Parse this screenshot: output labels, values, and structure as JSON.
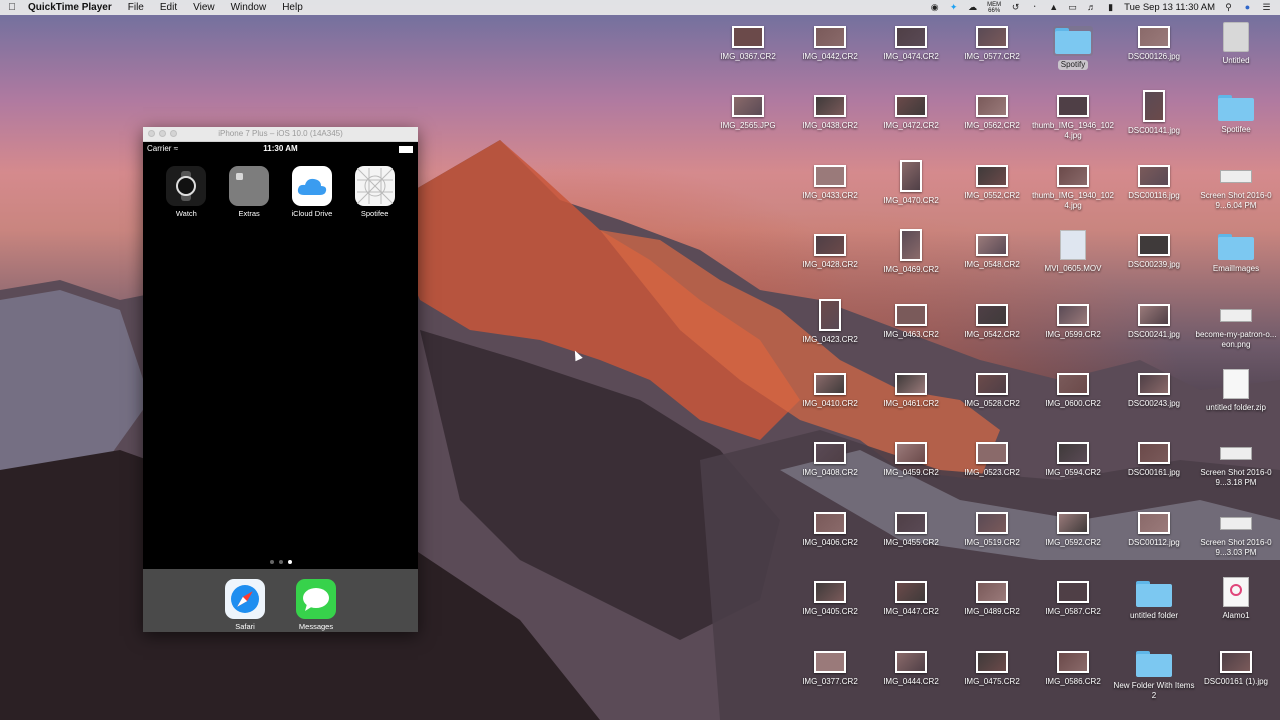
{
  "menubar": {
    "app_name": "QuickTime Player",
    "menus": [
      "File",
      "Edit",
      "View",
      "Window",
      "Help"
    ],
    "status": {
      "mem_label": "MEM",
      "mem_value": "66%",
      "clock": "Tue Sep 13  11:30 AM"
    }
  },
  "simulator": {
    "title": "iPhone 7 Plus – iOS 10.0 (14A345)",
    "carrier": "Carrier",
    "time": "11:30 AM",
    "apps": [
      {
        "label": "Watch",
        "icon": "watch-icon",
        "color": "#222222"
      },
      {
        "label": "Extras",
        "icon": "folder-extras-icon",
        "color": "#7d7d7d"
      },
      {
        "label": "iCloud Drive",
        "icon": "icloud-icon",
        "color": "#ffffff"
      },
      {
        "label": "Spotifee",
        "icon": "spotifee-icon",
        "color": "#f2f2f2"
      }
    ],
    "dock": [
      {
        "label": "Safari",
        "icon": "safari-icon",
        "color": "#e8f1fb"
      },
      {
        "label": "Messages",
        "icon": "messages-icon",
        "color": "#37d24b"
      }
    ],
    "pages": 3,
    "current_page": 3
  },
  "desktop": {
    "columns": [
      [
        {
          "label": "IMG_0367.CR2",
          "type": "photo"
        },
        {
          "label": "IMG_2565.JPG",
          "type": "photo"
        }
      ],
      [
        {
          "label": "IMG_0442.CR2",
          "type": "photo"
        },
        {
          "label": "IMG_0438.CR2",
          "type": "photo"
        },
        {
          "label": "IMG_0433.CR2",
          "type": "photo"
        },
        {
          "label": "IMG_0428.CR2",
          "type": "photo"
        },
        {
          "label": "IMG_0423.CR2",
          "type": "photo-tall"
        },
        {
          "label": "IMG_0410.CR2",
          "type": "photo"
        },
        {
          "label": "IMG_0408.CR2",
          "type": "photo"
        },
        {
          "label": "IMG_0406.CR2",
          "type": "photo"
        },
        {
          "label": "IMG_0405.CR2",
          "type": "photo"
        },
        {
          "label": "IMG_0377.CR2",
          "type": "photo"
        }
      ],
      [
        {
          "label": "IMG_0474.CR2",
          "type": "photo"
        },
        {
          "label": "IMG_0472.CR2",
          "type": "photo"
        },
        {
          "label": "IMG_0470.CR2",
          "type": "photo-tall"
        },
        {
          "label": "IMG_0469.CR2",
          "type": "photo-tall"
        },
        {
          "label": "IMG_0463.CR2",
          "type": "photo"
        },
        {
          "label": "IMG_0461.CR2",
          "type": "photo"
        },
        {
          "label": "IMG_0459.CR2",
          "type": "photo"
        },
        {
          "label": "IMG_0455.CR2",
          "type": "photo"
        },
        {
          "label": "IMG_0447.CR2",
          "type": "photo"
        },
        {
          "label": "IMG_0444.CR2",
          "type": "photo"
        }
      ],
      [
        {
          "label": "IMG_0577.CR2",
          "type": "photo"
        },
        {
          "label": "IMG_0562.CR2",
          "type": "photo"
        },
        {
          "label": "IMG_0552.CR2",
          "type": "photo"
        },
        {
          "label": "IMG_0548.CR2",
          "type": "photo"
        },
        {
          "label": "IMG_0542.CR2",
          "type": "photo"
        },
        {
          "label": "IMG_0528.CR2",
          "type": "photo"
        },
        {
          "label": "IMG_0523.CR2",
          "type": "photo"
        },
        {
          "label": "IMG_0519.CR2",
          "type": "photo"
        },
        {
          "label": "IMG_0489.CR2",
          "type": "photo"
        },
        {
          "label": "IMG_0475.CR2",
          "type": "photo"
        }
      ],
      [
        {
          "label": "Spotify",
          "type": "folder",
          "selected": true
        },
        {
          "label": "thumb_IMG_1946_1024.jpg",
          "type": "photo"
        },
        {
          "label": "thumb_IMG_1940_1024.jpg",
          "type": "photo"
        },
        {
          "label": "MVI_0605.MOV",
          "type": "movie"
        },
        {
          "label": "IMG_0599.CR2",
          "type": "photo"
        },
        {
          "label": "IMG_0600.CR2",
          "type": "photo"
        },
        {
          "label": "IMG_0594.CR2",
          "type": "photo"
        },
        {
          "label": "IMG_0592.CR2",
          "type": "photo"
        },
        {
          "label": "IMG_0587.CR2",
          "type": "photo"
        },
        {
          "label": "IMG_0586.CR2",
          "type": "photo"
        }
      ],
      [
        {
          "label": "DSC00126.jpg",
          "type": "photo"
        },
        {
          "label": "DSC00141.jpg",
          "type": "photo-tall"
        },
        {
          "label": "DSC00116.jpg",
          "type": "photo"
        },
        {
          "label": "DSC00239.jpg",
          "type": "photo"
        },
        {
          "label": "DSC00241.jpg",
          "type": "photo"
        },
        {
          "label": "DSC00243.jpg",
          "type": "photo"
        },
        {
          "label": "DSC00161.jpg",
          "type": "photo"
        },
        {
          "label": "DSC00112.jpg",
          "type": "photo"
        },
        {
          "label": "untitled folder",
          "type": "folder"
        },
        {
          "label": "New Folder With Items 2",
          "type": "folder"
        }
      ],
      [
        {
          "label": "Untitled",
          "type": "drive"
        },
        {
          "label": "Spotifee",
          "type": "folder"
        },
        {
          "label": "Screen Shot 2016-09...6.04 PM",
          "type": "screenshot"
        },
        {
          "label": "EmailImages",
          "type": "folder"
        },
        {
          "label": "become-my-patron-o...eon.png",
          "type": "screenshot"
        },
        {
          "label": "untitled folder.zip",
          "type": "zip"
        },
        {
          "label": "Screen Shot 2016-09...3.18 PM",
          "type": "screenshot"
        },
        {
          "label": "Screen Shot 2016-09...3.03 PM",
          "type": "screenshot"
        },
        {
          "label": "Alamo1",
          "type": "audio"
        },
        {
          "label": "DSC00161 (1).jpg",
          "type": "photo"
        }
      ]
    ]
  }
}
